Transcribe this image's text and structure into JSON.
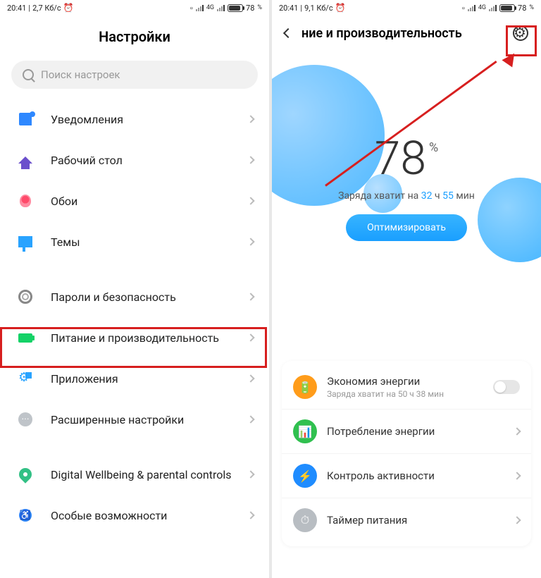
{
  "left": {
    "status": {
      "time": "20:41",
      "speed": "2,7 Кб/с",
      "battery": "78"
    },
    "title": "Настройки",
    "search_placeholder": "Поиск настроек",
    "items": [
      {
        "label": "Уведомления"
      },
      {
        "label": "Рабочий стол"
      },
      {
        "label": "Обои"
      },
      {
        "label": "Темы"
      }
    ],
    "items2": [
      {
        "label": "Пароли и безопасность"
      },
      {
        "label": "Питание и производительность"
      },
      {
        "label": "Приложения"
      },
      {
        "label": "Расширенные настройки"
      }
    ],
    "items3": [
      {
        "label": "Digital Wellbeing & parental controls"
      },
      {
        "label": "Особые возможности"
      }
    ]
  },
  "right": {
    "status": {
      "time": "20:41",
      "speed": "9,1 Кб/с",
      "battery": "78"
    },
    "title": "ние и производительность",
    "percent": "78",
    "percent_sym": "%",
    "estimate_prefix": "Заряда хватит на ",
    "estimate_h": "32",
    "estimate_h_unit": " ч ",
    "estimate_m": "55",
    "estimate_m_unit": " мин",
    "optimize": "Оптимизировать",
    "card": {
      "saver_title": "Экономия энергии",
      "saver_sub": "Заряда хватит на 50 ч 38 мин",
      "usage": "Потребление энергии",
      "activity": "Контроль активности",
      "timer": "Таймер питания"
    }
  }
}
